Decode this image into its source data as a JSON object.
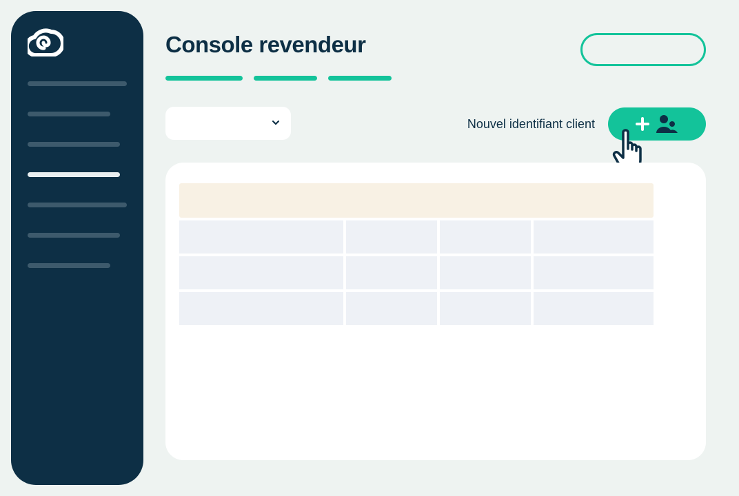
{
  "header": {
    "title": "Console revendeur"
  },
  "toolbar": {
    "new_client_label": "Nouvel identifiant client"
  },
  "colors": {
    "sidebar": "#0d2f45",
    "accent": "#13c39a",
    "table_header": "#f8f1e4",
    "table_cell": "#eef1f6"
  },
  "icons": {
    "logo": "swirl-logo-icon",
    "dropdown": "chevron-down-icon",
    "add": "plus-icon",
    "users": "users-icon",
    "cursor": "hand-pointer-icon"
  }
}
